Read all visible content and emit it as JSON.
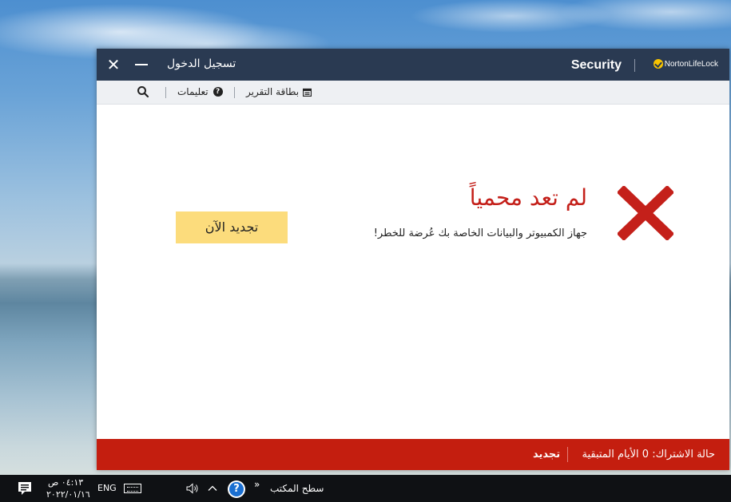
{
  "window": {
    "signin_label": "تسجيل الدخول",
    "close_label": "✕",
    "brand": "Security",
    "brand_logo": "NortonLifeLock"
  },
  "toolbar": {
    "report_card": "بطاقة التقرير",
    "help": "تعليمات",
    "help_glyph": "?"
  },
  "main": {
    "status_title": "لم تعد محمياً",
    "status_sub": "جهاز الكمبيوتر والبيانات الخاصة بك عُرضة للخطر!",
    "renew_button": "تجديد الآن"
  },
  "footer": {
    "subscription_status": "حالة الاشتراك: 0 الأيام المتبقية",
    "renew": "تجديد"
  },
  "taskbar": {
    "time": "٠٤:١٣ ص",
    "date": "٢٠٢٢/٠١/١٦",
    "language": "ENG",
    "desktop_label": "سطح المكتب",
    "desktop_chevron": "»",
    "help_glyph": "?"
  },
  "colors": {
    "titlebar": "#2a3a52",
    "alert_red": "#c41e0f",
    "renew_yellow": "#fcdc7c"
  }
}
